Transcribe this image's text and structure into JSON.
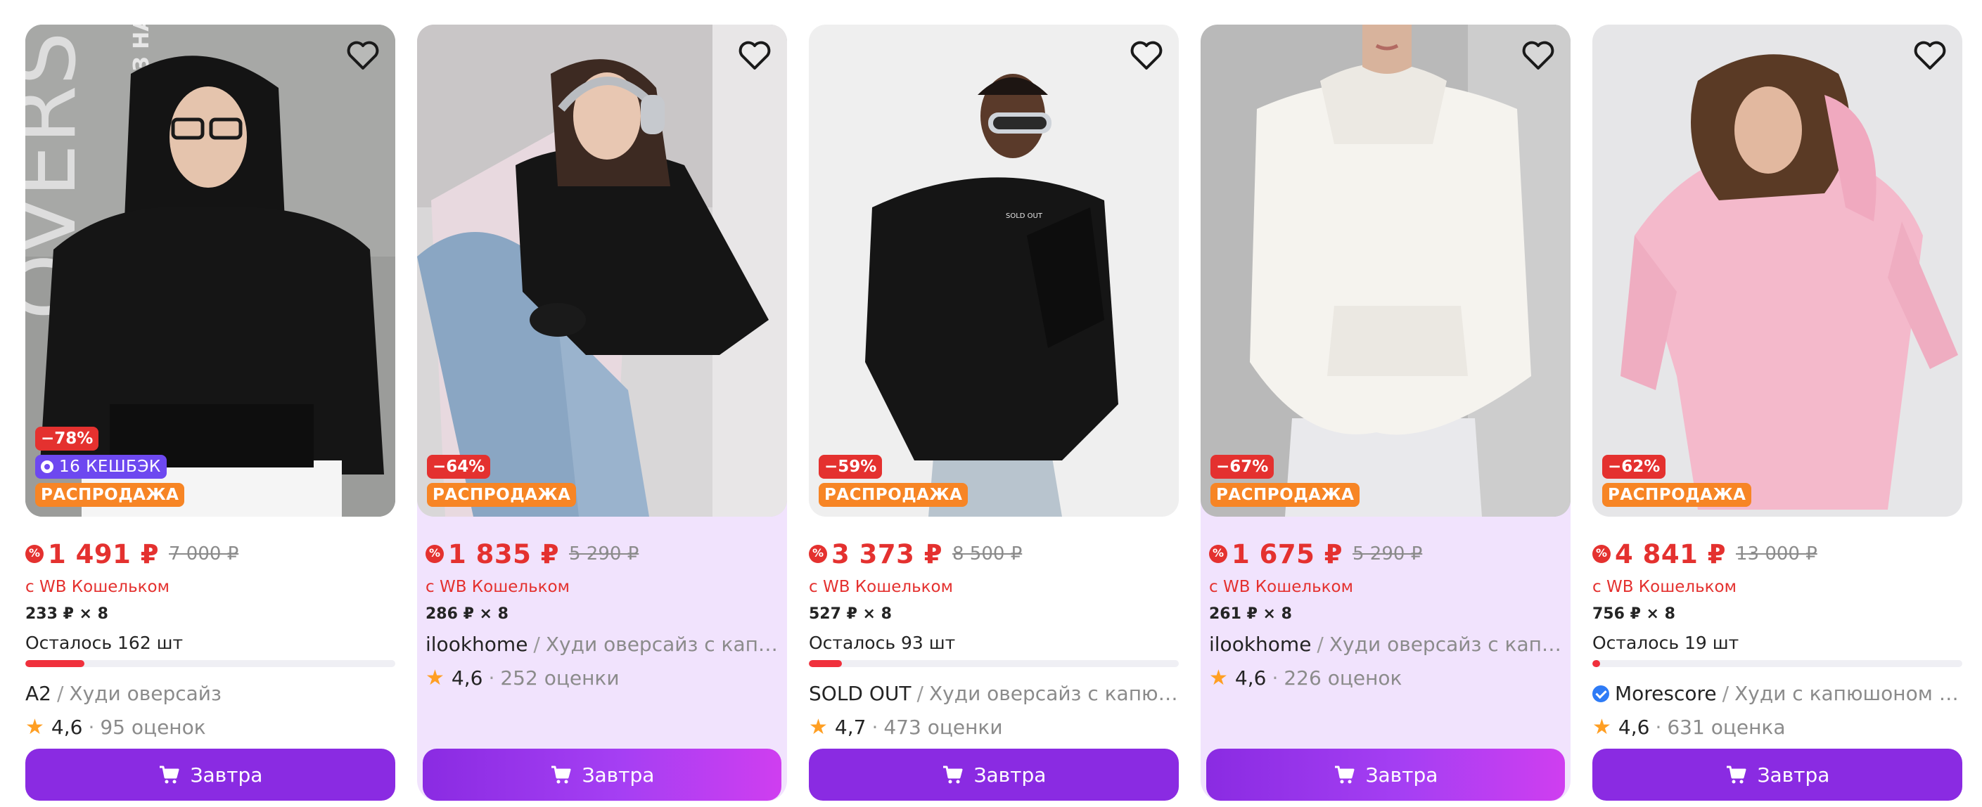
{
  "products": [
    {
      "discount": "−78%",
      "cashback": "16 КЕШБЭК",
      "sale": "РАСПРОДАЖА",
      "price": "1 491 ₽",
      "old_price": "7 000 ₽",
      "wallet": "с WB Кошельком",
      "installment": "233 ₽ × 8",
      "stock_left": "Осталось 162 шт",
      "stock_fraction": 0.16,
      "brand": "A2",
      "title": "Худи оверсайз",
      "rating": "4,6",
      "reviews": "95 оценок",
      "buy_label": "Завтра",
      "image_text_big": "OVERSIZE",
      "image_text_small": "БЕЗ НАЧЕСА"
    },
    {
      "discount": "−64%",
      "sale": "РАСПРОДАЖА",
      "price": "1 835 ₽",
      "old_price": "5 290 ₽",
      "wallet": "с WB Кошельком",
      "installment": "286 ₽ × 8",
      "brand": "ilookhome",
      "title": "Худи оверсайз с капюш...",
      "rating": "4,6",
      "reviews": "252 оценки",
      "buy_label": "Завтра"
    },
    {
      "discount": "−59%",
      "sale": "РАСПРОДАЖА",
      "price": "3 373 ₽",
      "old_price": "8 500 ₽",
      "wallet": "с WB Кошельком",
      "installment": "527 ₽ × 8",
      "stock_left": "Осталось 93 шт",
      "stock_fraction": 0.09,
      "brand": "SOLD OUT",
      "title": "Худи оверсайз с капюшо...",
      "rating": "4,7",
      "reviews": "473 оценки",
      "buy_label": "Завтра",
      "image_text_small": "SOLD OUT"
    },
    {
      "discount": "−67%",
      "sale": "РАСПРОДАЖА",
      "price": "1 675 ₽",
      "old_price": "5 290 ₽",
      "wallet": "с WB Кошельком",
      "installment": "261 ₽ × 8",
      "brand": "ilookhome",
      "title": "Худи оверсайз с капюш...",
      "rating": "4,6",
      "reviews": "226 оценок",
      "buy_label": "Завтра"
    },
    {
      "discount": "−62%",
      "sale": "РАСПРОДАЖА",
      "price": "4 841 ₽",
      "old_price": "13 000 ₽",
      "wallet": "с WB Кошельком",
      "installment": "756 ₽ × 8",
      "stock_left": "Осталось 19 шт",
      "stock_fraction": 0.02,
      "brand": "Morescore",
      "title": "Худи с капюшоном ове...",
      "rating": "4,6",
      "reviews": "631 оценка",
      "buy_label": "Завтра"
    }
  ],
  "colors": {
    "accent": "#8a2be2",
    "price": "#e4312f",
    "sale_badge": "#f78525",
    "cashback_badge": "#6d48f0",
    "promo_card_bg": "#f1e3fd",
    "star": "#ff9f23"
  }
}
